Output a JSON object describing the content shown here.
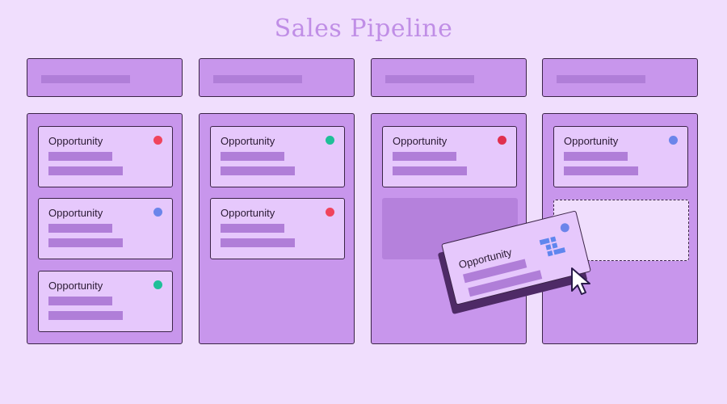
{
  "title": "Sales Pipeline",
  "colors": {
    "background": "#f0defd",
    "column": "#c896ec",
    "card": "#e6c8fc",
    "placeholder_bar": "#b07ed8",
    "outline": "#3b2447",
    "title": "#c08ee6",
    "status_red": "#f0445c",
    "status_blue": "#6b85ea",
    "status_green": "#1fbf98",
    "logo": "#5f86ee"
  },
  "columns": [
    {
      "cards": [
        {
          "label": "Opportunity",
          "status": "#f0445c"
        },
        {
          "label": "Opportunity",
          "status": "#6b85ea"
        },
        {
          "label": "Opportunity",
          "status": "#1fbf98"
        }
      ]
    },
    {
      "cards": [
        {
          "label": "Opportunity",
          "status": "#1fbf98"
        },
        {
          "label": "Opportunity",
          "status": "#f0445c"
        }
      ]
    },
    {
      "cards": [
        {
          "label": "Opportunity",
          "status": "#e0304e"
        }
      ],
      "ghost_slot": true
    },
    {
      "cards": [
        {
          "label": "Opportunity",
          "status": "#6b85ea"
        }
      ],
      "drop_zone": true
    }
  ],
  "dragging_card": {
    "label": "Opportunity",
    "status": "#6b85ea",
    "icon": "brand-logo-icon"
  },
  "cursor": "pointer-arrow-icon"
}
